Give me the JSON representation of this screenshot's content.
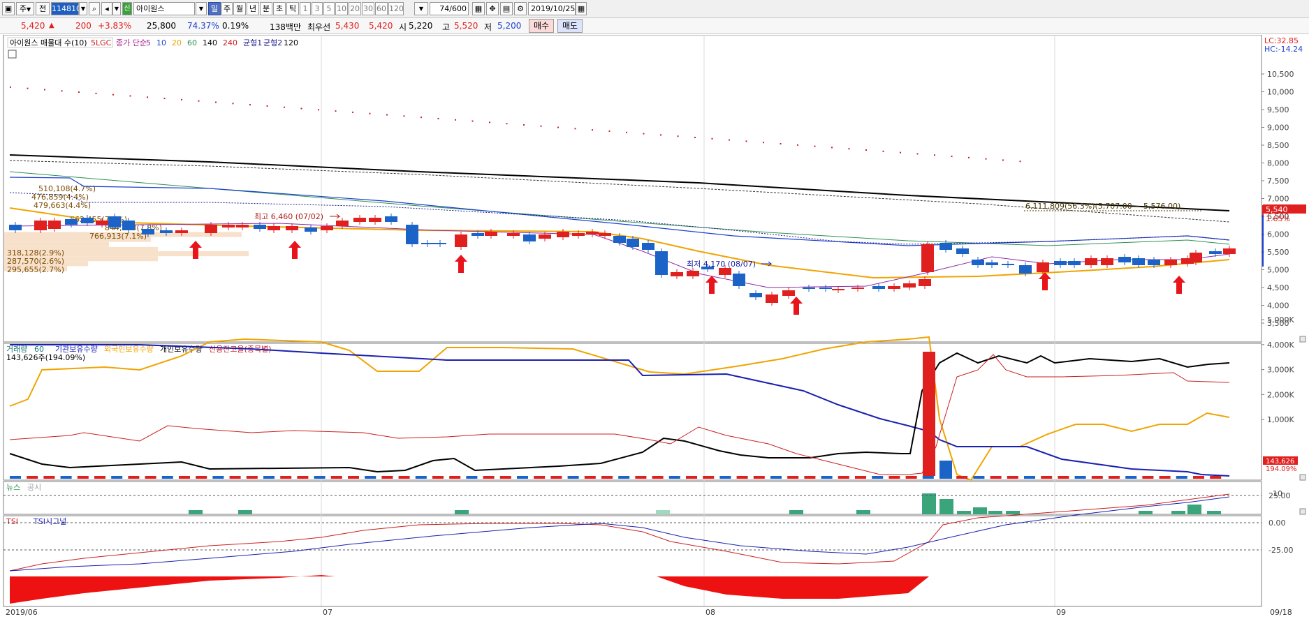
{
  "toolbar": {
    "type_select": "주",
    "mode_button": "전",
    "stock_code": "114810",
    "new_badge": "신",
    "stock_name": "아이원스",
    "periods": [
      "일",
      "주",
      "월",
      "년",
      "분",
      "초",
      "틱",
      "1",
      "3",
      "5",
      "10",
      "20",
      "30",
      "60",
      "120"
    ],
    "selected_period": "일",
    "count": "74",
    "count_total": "/600",
    "date": "2019/10/25"
  },
  "quote": {
    "price": "5,420",
    "arrow": "▲",
    "change": "200",
    "change_pct": "+3.83%",
    "volume": "25,800",
    "turnover_ratio": "74.37%",
    "ratio2": "0.19%",
    "amount": "138백만",
    "best_ask_label": "최우선",
    "best_ask": "5,430",
    "best_bid": "5,420",
    "open_label": "시",
    "open": "5,220",
    "high_label": "고",
    "high": "5,520",
    "low_label": "저",
    "low": "5,200",
    "buy_button": "매수",
    "sell_button": "매도"
  },
  "price_pane": {
    "legend": [
      {
        "text": "아이원스 매물대 수(10)",
        "color": "#000000"
      },
      {
        "text": "5LGC",
        "color": "#cc1f1f"
      },
      {
        "text": "종가 단순",
        "color": "#b0238e"
      },
      {
        "text": "5",
        "color": "#8d2aa8"
      },
      {
        "text": "10",
        "color": "#1a3fd0"
      },
      {
        "text": "20",
        "color": "#f0a400"
      },
      {
        "text": "60",
        "color": "#2f8f4f"
      },
      {
        "text": "140",
        "color": "#000000"
      },
      {
        "text": "240",
        "color": "#cc1f1f"
      },
      {
        "text": "균형1",
        "color": "#1b1b8a"
      },
      {
        "text": "균형2",
        "color": "#1b1b8a"
      },
      {
        "text": "120",
        "color": "#000000"
      }
    ],
    "lc": "LC:32.85",
    "hc": "HC:-14.24",
    "y_ticks": [
      "10,500",
      "10,000",
      "9,500",
      "9,000",
      "8,500",
      "8,000",
      "7,500",
      "7,000",
      "6,500",
      "6,000",
      "5,500",
      "5,000",
      "4,500",
      "4,000",
      "3,500"
    ],
    "price_tag": "5,540",
    "pct_tag": "1.65%",
    "high_annotation": "최고 6,460 (07/02)",
    "low_annotation": "최저 4,170 (08/07)",
    "range_annotation": "6,111,809(56.3%)(5,707.00 ~ 5,576.00)",
    "volume_profile_labels": [
      "510,108(4.7%)",
      "476,859(4.4%)",
      "479,663(4.4%)",
      "762,455(7.0%)",
      "844,183(7.8%)",
      "766,913(7.1%)",
      "318,128(2.9%)",
      "287,570(2.6%)",
      "295,655(2.7%)"
    ]
  },
  "volume_pane": {
    "legend": [
      {
        "text": "거래량",
        "color": "#1f7a7a"
      },
      {
        "text": "60",
        "color": "#1f7a7a"
      },
      {
        "text": "기관보유수량",
        "color": "#1a1fb0"
      },
      {
        "text": "외국인보유수량",
        "color": "#f0a400"
      },
      {
        "text": "개인보유수량",
        "color": "#000000"
      },
      {
        "text": "신용잔고율(종목별)",
        "color": "#cc1f1f"
      }
    ],
    "subtitle": "143,626주(194.09%)",
    "y_ticks": [
      "5,000K",
      "4,000K",
      "3,000K",
      "2,000K",
      "1,000K"
    ],
    "tag1": "143,626",
    "tag2": "194.09%"
  },
  "news_pane": {
    "legend": [
      {
        "text": "뉴스",
        "color": "#2f8f4f"
      },
      {
        "text": "공시",
        "color": "#a0a0a0"
      }
    ],
    "y_tick": "10"
  },
  "tsi_pane": {
    "legend": [
      {
        "text": "TSI",
        "color": "#cc1f1f"
      },
      {
        "text": "TSI시그널",
        "color": "#1a1fb0"
      }
    ],
    "y_ticks": [
      "25.00",
      "0.00",
      "-25.00"
    ]
  },
  "x_axis": {
    "labels": [
      "2019/06",
      "07",
      "08",
      "09",
      "09/18"
    ]
  },
  "colors": {
    "up": "#e0201f",
    "down": "#1b63c6",
    "ma5": "#8d2aa8",
    "ma10": "#1a3fd0",
    "ma20": "#f0a400",
    "ma60": "#2f8f4f",
    "ma140": "#000000",
    "news": "#3aa57a",
    "profile": "#f6dcc2"
  }
}
